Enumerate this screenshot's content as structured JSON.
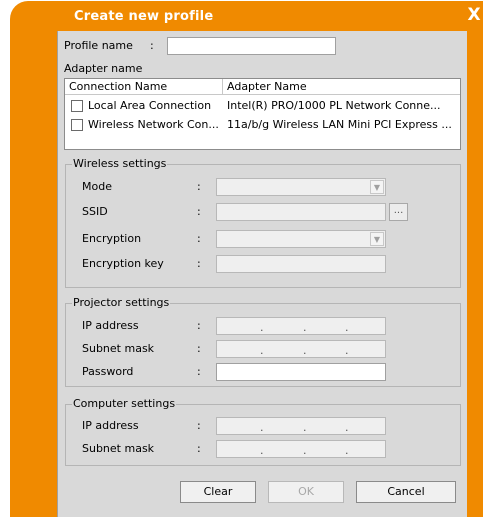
{
  "window": {
    "title": "Create new profile",
    "close_glyph": "X",
    "accent": "#f08a00"
  },
  "profile": {
    "label": "Profile name",
    "colon": ":",
    "value": ""
  },
  "adapter": {
    "section_label": "Adapter name",
    "columns": [
      "Connection Name",
      "Adapter Name"
    ],
    "rows": [
      {
        "connection": "Local Area Connection",
        "adapter": "Intel(R) PRO/1000 PL Network Conne...",
        "checked": false
      },
      {
        "connection": "Wireless Network Con...",
        "adapter": "11a/b/g Wireless LAN Mini PCI Express ...",
        "checked": false
      }
    ]
  },
  "wireless": {
    "title": "Wireless settings",
    "mode_label": "Mode",
    "ssid_label": "SSID",
    "encryption_label": "Encryption",
    "encryption_key_label": "Encryption key",
    "colon": ":",
    "ellipsis": "...",
    "arrow": "▼"
  },
  "projector": {
    "title": "Projector settings",
    "ip_label": "IP address",
    "subnet_label": "Subnet mask",
    "password_label": "Password",
    "colon": ":"
  },
  "computer": {
    "title": "Computer settings",
    "ip_label": "IP address",
    "subnet_label": "Subnet mask",
    "colon": ":"
  },
  "ip_dot": ".",
  "buttons": {
    "clear": "Clear",
    "ok": "OK",
    "cancel": "Cancel"
  }
}
